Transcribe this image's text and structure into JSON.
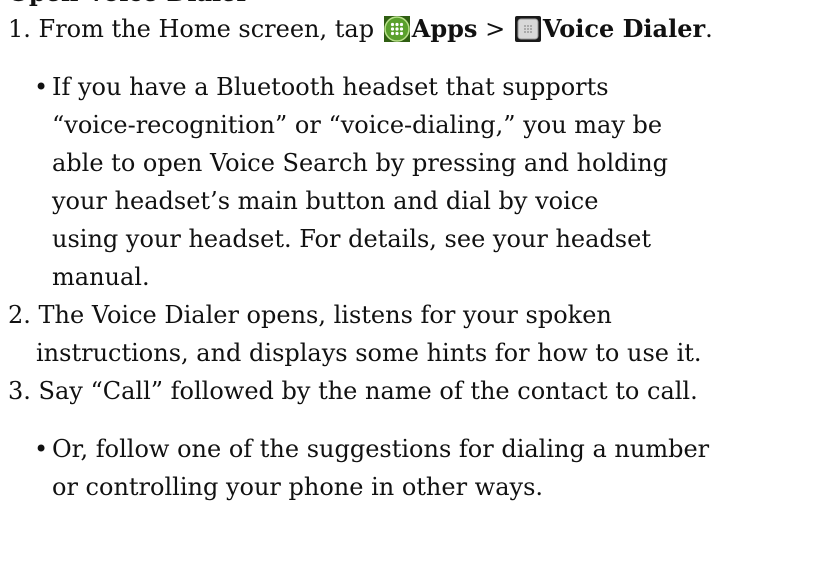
{
  "doc": {
    "partial_heading": "Open Voice Dialer",
    "step1": {
      "number": "1.",
      "text_before": "From the Home screen, tap",
      "apps_label": "Apps",
      "separator": ">",
      "voice_dialer_label": "Voice Dialer",
      "period": ".",
      "apps_icon": "apps-grid-icon",
      "voice_dialer_icon": "voice-dialer-app-icon"
    },
    "bullet1_lines": [
      "If you have a Bluetooth headset that supports",
      "“voice-recognition” or “voice-dialing,” you may be",
      "able to open Voice Search by pressing and holding",
      "your headset’s main button and dial by voice",
      "using your headset. For details, see your headset",
      "manual."
    ],
    "step2_lines": [
      "2. The Voice Dialer opens, listens for your spoken",
      "instructions, and displays some hints for how to use it."
    ],
    "step3_line": "3. Say “Call” followed by the name of the contact to call.",
    "bullet2_lines": [
      "Or, follow one of the suggestions for dialing a number",
      "or controlling your phone in other ways."
    ],
    "bullet_char": "•",
    "colors": {
      "text": "#111111",
      "apps_icon_green": "#5aa02c",
      "voice_icon_gray": "#9a9a9a"
    }
  }
}
